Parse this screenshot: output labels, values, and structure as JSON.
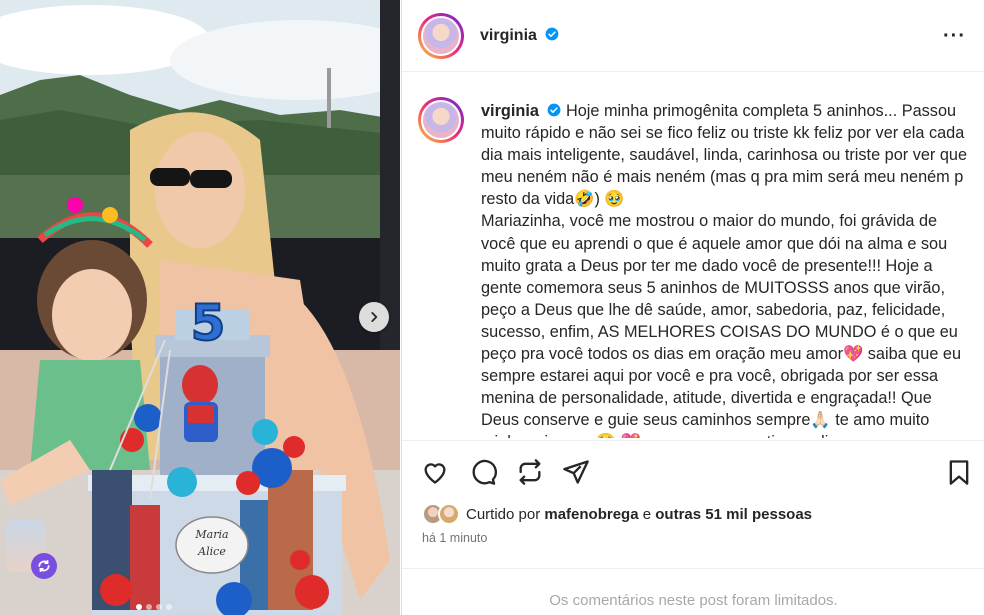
{
  "post": {
    "username": "virginia",
    "more_icon": "···",
    "caption": {
      "username": "virginia",
      "line1": "Hoje minha primogênita completa 5 aninhos... Passou muito rápido e não sei se fico feliz ou triste kk feliz por ver ela cada dia mais inteligente, saudável, linda, carinhosa ou triste por ver que meu neném não é mais neném (mas q pra mim será meu neném p resto da vida🤣) 🥹",
      "line2": "Mariazinha, você me mostrou o maior do mundo, foi grávida de você que eu aprendi o que é aquele amor que dói na alma e sou muito grata a Deus por ter me dado você de presente!!! Hoje a gente comemora seus 5 aninhos de MUITOSSS anos que virão, peço a Deus que lhe dê saúde, amor, sabedoria, paz, felicidade, sucesso, enfim, AS MELHORES COISAS DO MUNDO é o que eu peço pra você todos os dias em oração meu amor💖 saiba que eu sempre estarei aqui por você e pra você, obrigada por ser essa menina de personalidade, atitude, divertida e engraçada!! Que Deus conserve e guie seus caminhos sempre🙏🏻 te amo muito minha princesa 🥹 💖 agora vamos curtir seu diaaaa e comemorar"
    },
    "likes": {
      "prefix": "Curtido por",
      "user": "mafenobrega",
      "connector": "e",
      "others": "outras 51 mil pessoas"
    },
    "time": "há 1 minuto",
    "comments_limited": "Os comentários neste post foram limitados."
  },
  "photo": {
    "cake_number": "5",
    "cake_topper": "Maria Alice"
  },
  "icons": [
    "heart-icon",
    "comment-icon",
    "share-icon",
    "send-icon",
    "bookmark-icon",
    "chevron-right-icon",
    "verified-icon",
    "remix-icon"
  ],
  "colors": {
    "verified": "#0095f6",
    "remix": "#7a4fe0",
    "muted": "#737373"
  }
}
